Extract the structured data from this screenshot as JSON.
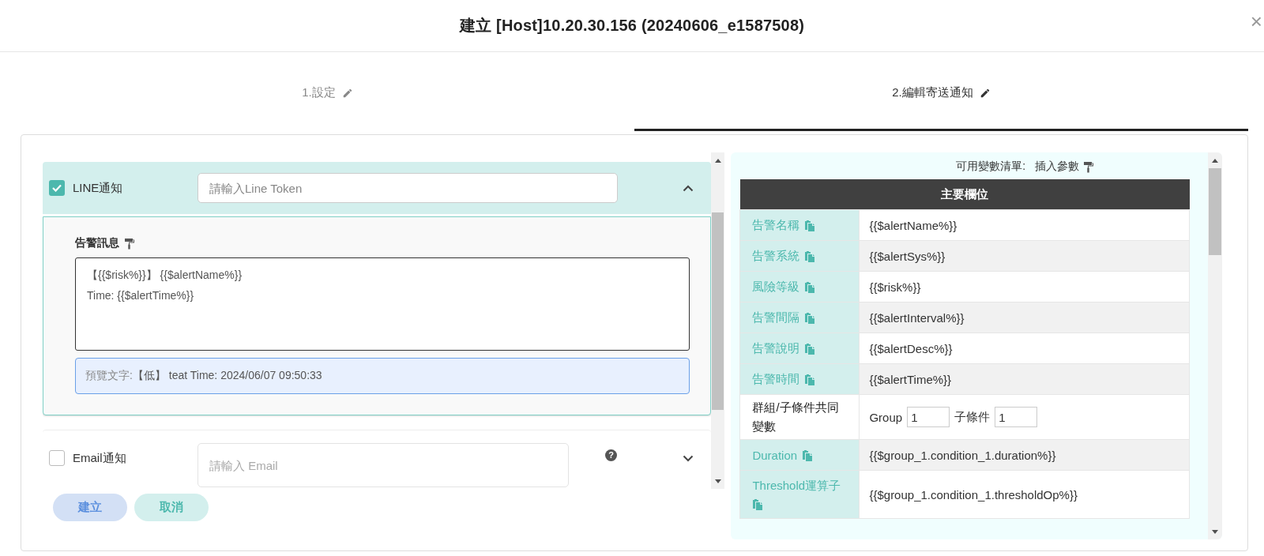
{
  "dialog": {
    "title": "建立 [Host]10.20.30.156 (20240606_e1587508)",
    "close": "×"
  },
  "tabs": [
    {
      "label": "1.設定",
      "selected": false
    },
    {
      "label": "2.編輯寄送通知",
      "selected": true
    }
  ],
  "channels": [
    {
      "label": "LINE通知",
      "checked": true,
      "expanded": true,
      "placeholder": "請輸入Line Token",
      "message_label": "告警訊息",
      "message": [
        "【{{$risk%}}】 {{$alertName%}}",
        "Time: {{$alertTime%}}"
      ],
      "preview_label": "預覽文字:",
      "preview": "【低】 teat Time: 2024/06/07 09:50:33"
    },
    {
      "label": "Email通知",
      "checked": false,
      "expanded": false,
      "placeholder": "請輸入 Email",
      "help": "?"
    }
  ],
  "buttons": [
    {
      "label": "建立",
      "kind": "primary"
    },
    {
      "label": "取消",
      "kind": "secondary"
    }
  ],
  "variables": {
    "title": "可用變數清單:",
    "insert_label": "插入參數",
    "header": "主要欄位",
    "rows": [
      {
        "kind": "var",
        "name": "告警名稱",
        "value": "{{$alertName%}}"
      },
      {
        "kind": "var",
        "name": "告警系統",
        "value": "{{$alertSys%}}"
      },
      {
        "kind": "var",
        "name": "風險等級",
        "value": "{{$risk%}}"
      },
      {
        "kind": "var",
        "name": "告警間隔",
        "value": "{{$alertInterval%}}"
      },
      {
        "kind": "var",
        "name": "告警說明",
        "value": "{{$alertDesc%}}"
      },
      {
        "kind": "var",
        "name": "告警時間",
        "value": "{{$alertTime%}}"
      },
      {
        "kind": "group",
        "name": "群組/子條件共同變數",
        "group_label": "Group",
        "group_value": "1",
        "sub_label": "子條件",
        "sub_value": "1"
      },
      {
        "kind": "var",
        "name": "Duration",
        "value": "{{$group_1.condition_1.duration%}}"
      },
      {
        "kind": "var",
        "name": "Threshold運算子",
        "value": "{{$group_1.condition_1.thresholdOp%}}"
      }
    ]
  }
}
